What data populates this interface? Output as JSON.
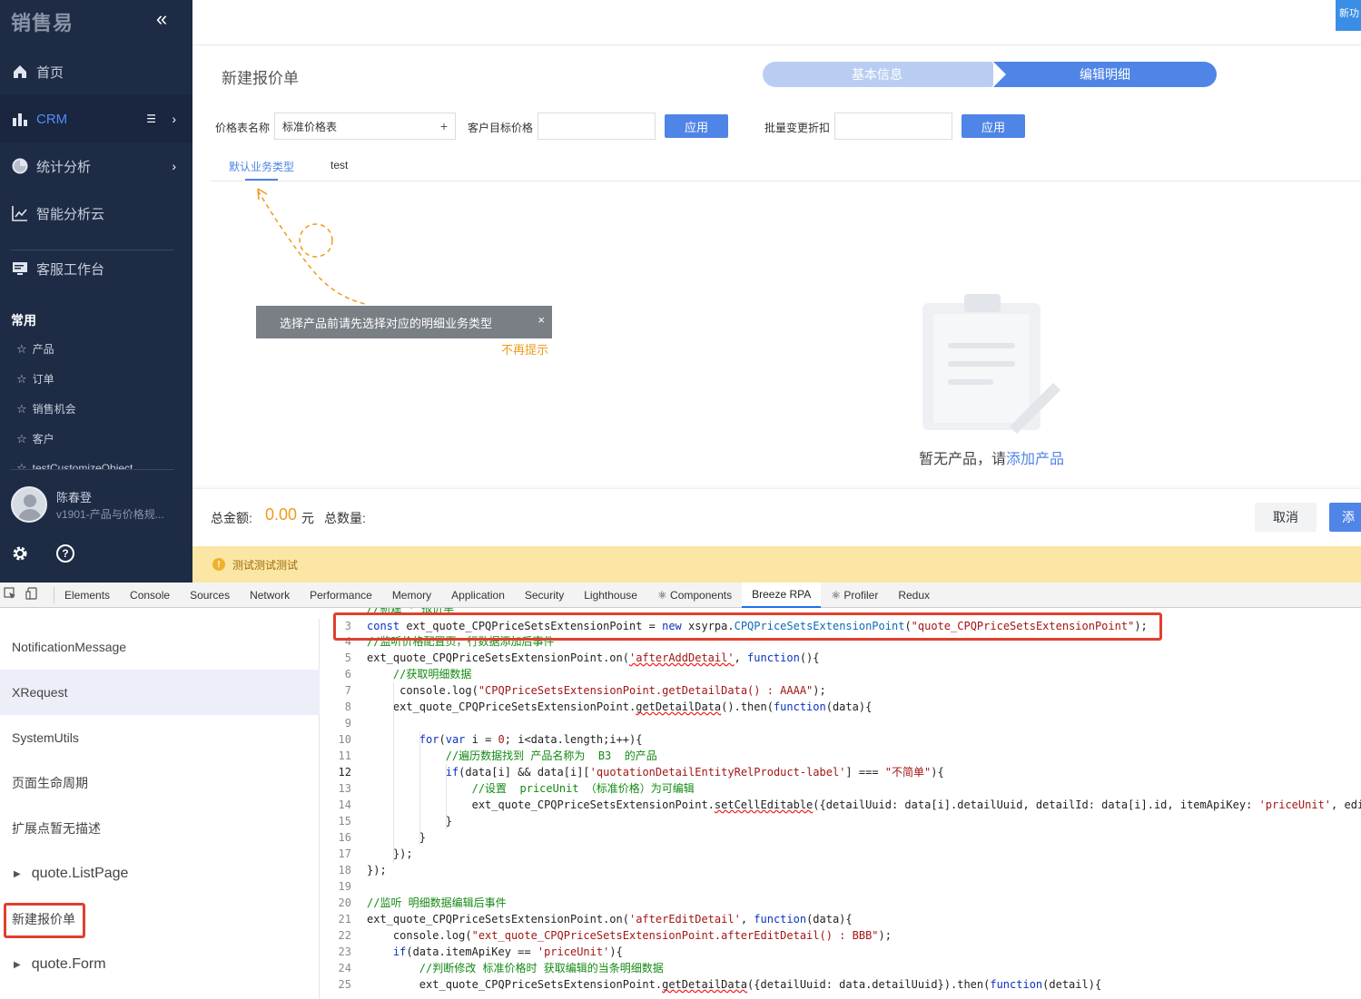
{
  "sidebar": {
    "logo": "销售易",
    "collapse_icon": "«",
    "nav": [
      {
        "label": "首页"
      },
      {
        "label": "CRM"
      },
      {
        "label": "统计分析"
      },
      {
        "label": "智能分析云"
      },
      {
        "label": "客服工作台"
      }
    ],
    "common_title": "常用",
    "favorites": [
      "产品",
      "订单",
      "销售机会",
      "客户",
      "testCustomizeObject"
    ],
    "user": {
      "name": "陈春登",
      "role": "v1901-产品与价格规..."
    }
  },
  "header": {
    "new_badge": "新功"
  },
  "page": {
    "title": "新建报价单",
    "steps": [
      "基本信息",
      "编辑明细"
    ],
    "form": {
      "price_list_label": "价格表名称",
      "price_list_value": "标准价格表",
      "target_price_label": "客户目标价格",
      "discount_label": "批量变更折扣",
      "apply_label": "应用"
    },
    "tabs": [
      "默认业务类型",
      "test"
    ],
    "tip": "选择产品前请先选择对应的明细业务类型",
    "tip_close": "×",
    "no_more": "不再提示",
    "empty_text": "暂无产品，请",
    "empty_link": "添加产品",
    "footer": {
      "total_label": "总金额:",
      "total_value": "0.00",
      "unit": "元",
      "qty_label": "总数量:",
      "cancel": "取消",
      "add": "添"
    },
    "notice": "测试测试测试"
  },
  "devtools": {
    "tabs": [
      "Elements",
      "Console",
      "Sources",
      "Network",
      "Performance",
      "Memory",
      "Application",
      "Security",
      "Lighthouse",
      "⚛ Components",
      "Breeze RPA",
      "⚛ Profiler",
      "Redux"
    ],
    "active_tab": "Breeze RPA",
    "left_items": [
      "NotificationMessage",
      "XRequest",
      "SystemUtils",
      "页面生命周期",
      "扩展点暂无描述",
      "quote.ListPage",
      "新建报价单",
      "quote.Form"
    ],
    "line_numbers": [
      "3",
      "4",
      "5",
      "6",
      "7",
      "8",
      "9",
      "10",
      "11",
      "12",
      "13",
      "14",
      "15",
      "16",
      "17",
      "18",
      "19",
      "20",
      "21",
      "22",
      "23",
      "24",
      "25"
    ]
  },
  "colors": {
    "sidebar_bg": "#1e2b45",
    "accent": "#4f85e6",
    "orange": "#f09a1b",
    "notice_bg": "#fbe6a5",
    "highlight_red": "#e0402f"
  }
}
